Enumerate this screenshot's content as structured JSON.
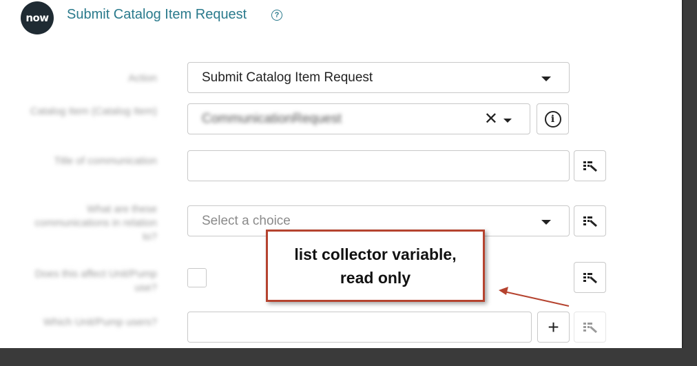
{
  "header": {
    "logo_text": "now",
    "title": "Submit Catalog Item Request",
    "help_icon": "question-circle-icon"
  },
  "form": {
    "action": {
      "label": "Action",
      "value": "Submit Catalog Item Request"
    },
    "catalog_item": {
      "label": "Catalog Item (Catalog Item)",
      "value": "CommunicationRequest"
    },
    "title_field": {
      "label": "Title of communication",
      "value": ""
    },
    "choice_field": {
      "label": "What are these communications in relation to?",
      "placeholder": "Select a choice"
    },
    "checkbox_field": {
      "label": "Does this affect Unit/Pump use?"
    },
    "list_collector": {
      "label": "Which Unit/Pump users?",
      "value": ""
    }
  },
  "icons": {
    "info": "info-icon",
    "data_pill_picker": "data-pill-picker-icon",
    "plus": "plus-icon",
    "clear": "close-icon",
    "dropdown": "chevron-down-icon"
  },
  "annotation": {
    "line1": "list collector variable,",
    "line2": "read only",
    "border_color": "#b5432f"
  },
  "colors": {
    "title": "#2a7a8c",
    "logo_bg": "#1f2b33",
    "background": "#3a3a3a"
  }
}
